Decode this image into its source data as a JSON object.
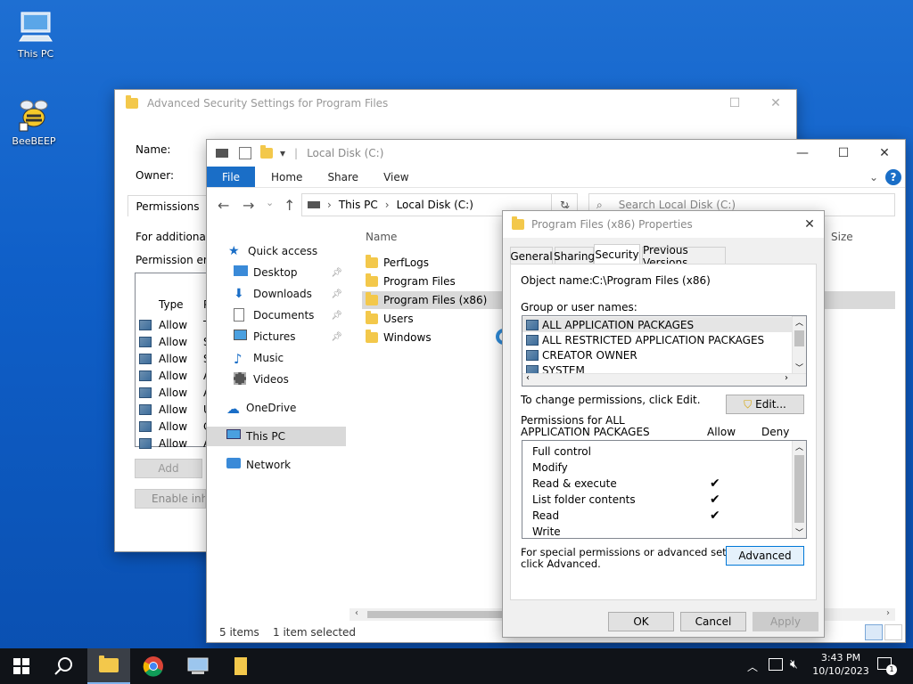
{
  "desktop": {
    "icons": [
      {
        "label": "This PC"
      },
      {
        "label": "BeeBEEP"
      }
    ]
  },
  "adv_security": {
    "title": "Advanced Security Settings for Program Files",
    "name_label": "Name:",
    "owner_label": "Owner:",
    "tab_permissions": "Permissions",
    "info_text": "For additional i",
    "perm_entries_text": "Permission entri",
    "col_type": "Type",
    "col_p": "P",
    "rows": [
      {
        "type": "Allow",
        "p": "T"
      },
      {
        "type": "Allow",
        "p": "S"
      },
      {
        "type": "Allow",
        "p": "S"
      },
      {
        "type": "Allow",
        "p": "A"
      },
      {
        "type": "Allow",
        "p": "A"
      },
      {
        "type": "Allow",
        "p": "U"
      },
      {
        "type": "Allow",
        "p": "C"
      },
      {
        "type": "Allow",
        "p": "A"
      }
    ],
    "add_button": "Add",
    "enable_inherit_button": "Enable inhe"
  },
  "explorer": {
    "title": "Local Disk (C:)",
    "ribbon": {
      "file": "File",
      "home": "Home",
      "share": "Share",
      "view": "View"
    },
    "breadcrumb": [
      "This PC",
      "Local Disk (C:)"
    ],
    "search_placeholder": "Search Local Disk (C:)",
    "col_name": "Name",
    "col_size": "Size",
    "nav": [
      {
        "label": "Quick access"
      },
      {
        "label": "Desktop"
      },
      {
        "label": "Downloads"
      },
      {
        "label": "Documents"
      },
      {
        "label": "Pictures"
      },
      {
        "label": "Music"
      },
      {
        "label": "Videos"
      },
      {
        "label": "OneDrive"
      },
      {
        "label": "This PC"
      },
      {
        "label": "Network"
      }
    ],
    "files": [
      "PerfLogs",
      "Program Files",
      "Program Files (x86)",
      "Users",
      "Windows"
    ],
    "status_items": "5 items",
    "status_selected": "1 item selected"
  },
  "props": {
    "title": "Program Files (x86) Properties",
    "tabs": [
      "General",
      "Sharing",
      "Security",
      "Previous Versions"
    ],
    "object_label": "Object name:",
    "object_value": "C:\\Program Files (x86)",
    "group_label": "Group or user names:",
    "groups": [
      "ALL APPLICATION PACKAGES",
      "ALL RESTRICTED APPLICATION PACKAGES",
      "CREATOR OWNER",
      "SYSTEM"
    ],
    "change_text": "To change permissions, click Edit.",
    "edit_button": "Edit...",
    "perm_for_1": "Permissions for ALL",
    "perm_for_2": "APPLICATION PACKAGES",
    "allow_col": "Allow",
    "deny_col": "Deny",
    "perms": [
      {
        "name": "Full control",
        "allow": ""
      },
      {
        "name": "Modify",
        "allow": ""
      },
      {
        "name": "Read & execute",
        "allow": "✔"
      },
      {
        "name": "List folder contents",
        "allow": "✔"
      },
      {
        "name": "Read",
        "allow": "✔"
      },
      {
        "name": "Write",
        "allow": ""
      }
    ],
    "special_1": "For special permissions or advanced settings,",
    "special_2": "click Advanced.",
    "advanced_button": "Advanced",
    "ok_button": "OK",
    "cancel_button": "Cancel",
    "apply_button": "Apply"
  },
  "taskbar": {
    "time": "3:43 PM",
    "date": "10/10/2023",
    "notif_count": "1"
  }
}
